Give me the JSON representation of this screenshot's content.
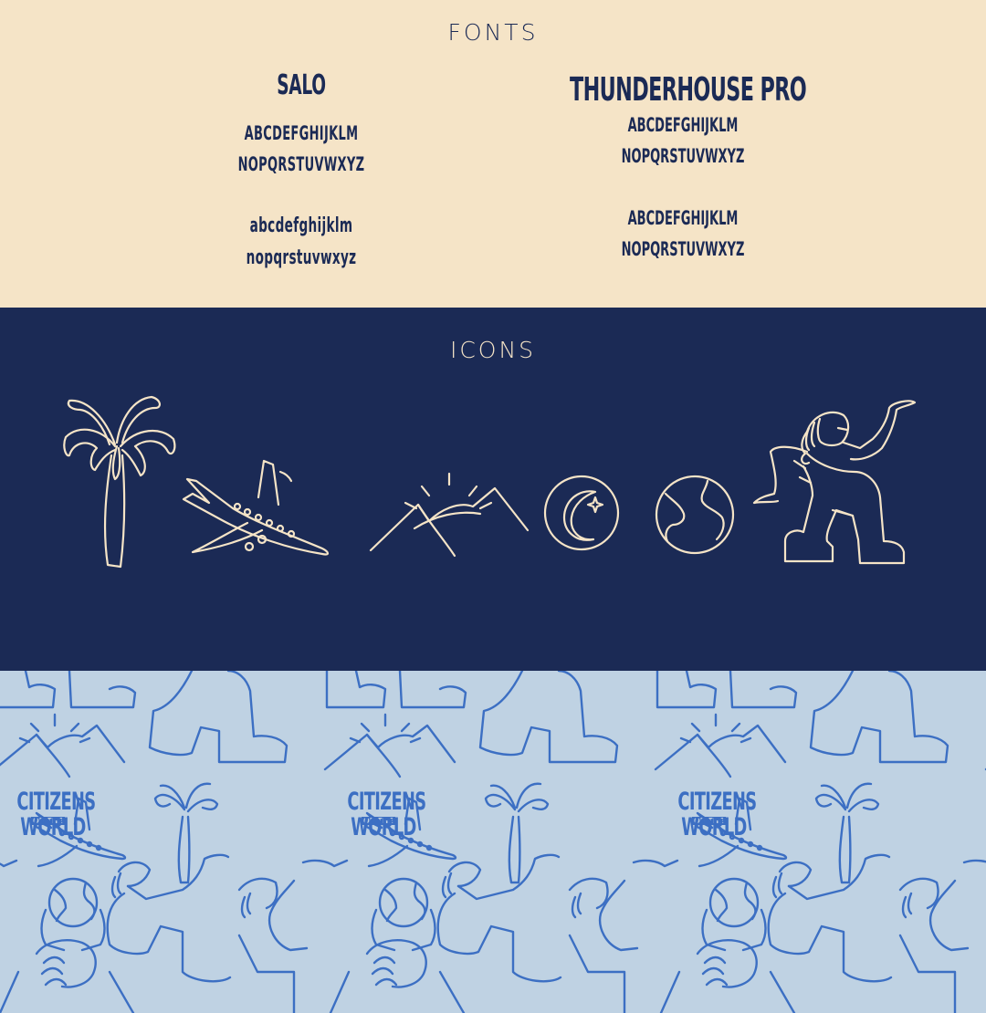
{
  "fonts": {
    "title": "FONTS",
    "salo": {
      "name": "SALO",
      "upper_1": "ABCDEFGHIJKLM",
      "upper_2": "NOPQRSTUVWXYZ",
      "lower_1": "abcdefghijklm",
      "lower_2": "nopqrstuvwxyz"
    },
    "thunderhouse": {
      "name": "THUNDERHOUSE PRO",
      "set1_line1": "ABCDEFGHIJKLM",
      "set1_line2": "NOPQRSTUVWXYZ",
      "set2_line1": "ABCDEFGHIJKLM",
      "set2_line2": "NOPQRSTUVWXYZ"
    }
  },
  "icons": {
    "title": "ICONS",
    "items": [
      "palm-tree-icon",
      "airplane-icon",
      "sunrise-mountains-icon",
      "moon-icon",
      "globe-icon",
      "crouching-figure-icon"
    ]
  },
  "pattern": {
    "logo_line_1": "CITIZENS",
    "logo_of_the": "OF THE",
    "logo_line_2": "WORLD"
  },
  "colors": {
    "cream": "#f5e4c7",
    "navy": "#1b2a55",
    "pattern_bg": "#bfd2e3",
    "pattern_ink": "#3c6fc3"
  }
}
